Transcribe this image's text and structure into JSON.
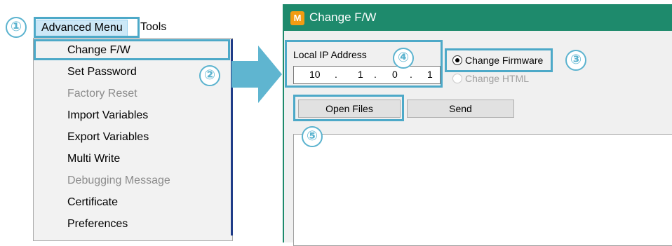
{
  "menubar": {
    "advanced_label": "Advanced Menu",
    "tools_label": "Tools"
  },
  "dropdown": {
    "items": [
      {
        "label": "Change F/W",
        "enabled": true
      },
      {
        "label": "Set Password",
        "enabled": true
      },
      {
        "label": "Factory Reset",
        "enabled": false
      },
      {
        "label": "Import Variables",
        "enabled": true
      },
      {
        "label": "Export Variables",
        "enabled": true
      },
      {
        "label": "Multi Write",
        "enabled": true
      },
      {
        "label": "Debugging Message",
        "enabled": false
      },
      {
        "label": "Certificate",
        "enabled": true
      },
      {
        "label": "Preferences",
        "enabled": true
      }
    ]
  },
  "window": {
    "title": "Change F/W",
    "icon_letter": "M",
    "ip_label": "Local IP Address",
    "ip": [
      "10",
      ".",
      "1",
      ".",
      "0",
      ".",
      "1"
    ],
    "radio_firmware": "Change Firmware",
    "radio_html": "Change HTML",
    "open_files": "Open Files",
    "send": "Send"
  },
  "steps": {
    "s1": "①",
    "s2": "②",
    "s3": "③",
    "s4": "④",
    "s5": "⑤"
  },
  "colors": {
    "accent": "#4da9c8",
    "titlebar": "#1e8a6c",
    "arrow": "#5fb5d0"
  }
}
